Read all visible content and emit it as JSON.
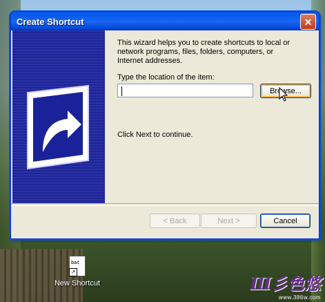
{
  "window": {
    "title": "Create Shortcut",
    "close_glyph": "✕"
  },
  "wizard": {
    "description": "This wizard helps you to create shortcuts to local or network programs, files, folders, computers, or Internet addresses.",
    "location_label": "Type the location of the item:",
    "location_value": "",
    "browse_label": "Browse...",
    "next_hint": "Click Next to continue."
  },
  "buttons": {
    "back": "< Back",
    "next": "Next >",
    "cancel": "Cancel"
  },
  "desktop": {
    "icon_label": "New Shortcut",
    "icon_badge": "bat"
  },
  "watermark": {
    "text": "Ш彡色悠",
    "url": "www.386w.com"
  },
  "icons": [
    "shortcut-arrow-icon",
    "close-icon",
    "mouse-pointer-icon",
    "shortcut-file-icon"
  ],
  "colors": {
    "titlebar": "#0058ee",
    "banner": "#2b31a8",
    "dialog_bg": "#ece9d8"
  }
}
